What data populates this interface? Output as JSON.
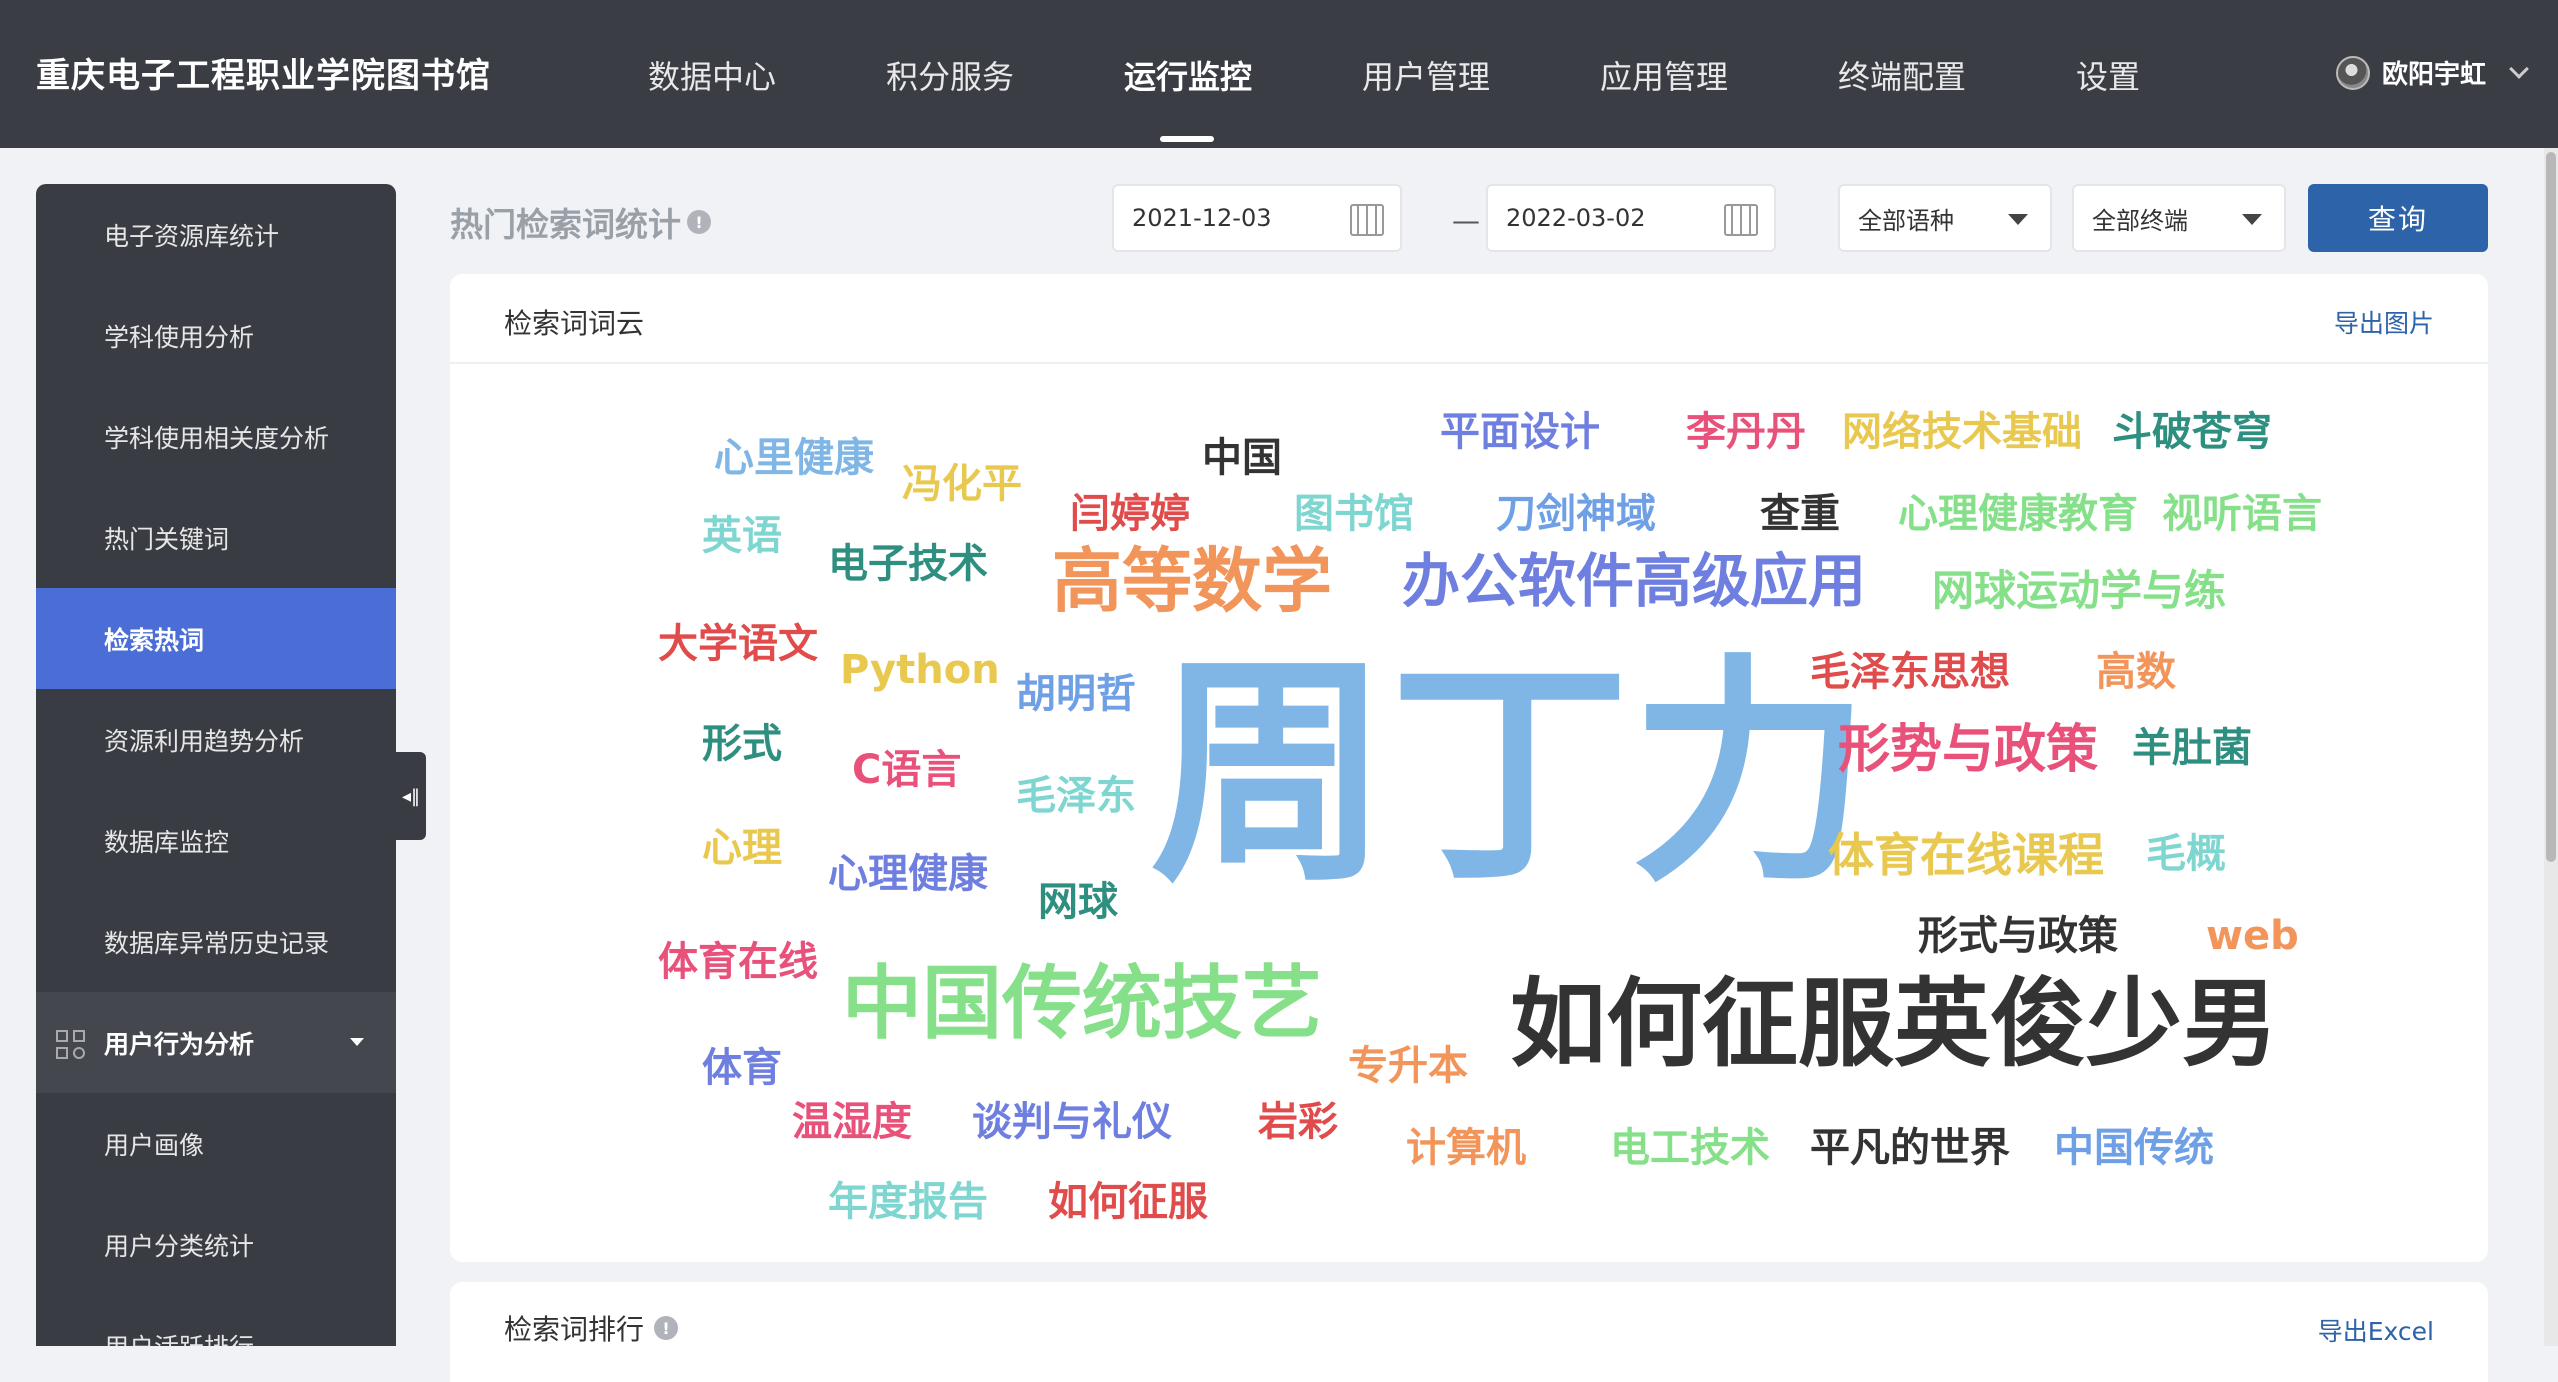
{
  "header": {
    "brand": "重庆电子工程职业学院图书馆",
    "nav": [
      {
        "label": "数据中心"
      },
      {
        "label": "积分服务"
      },
      {
        "label": "运行监控",
        "active": true
      },
      {
        "label": "用户管理"
      },
      {
        "label": "应用管理"
      },
      {
        "label": "终端配置"
      },
      {
        "label": "设置"
      }
    ],
    "user_name": "欧阳宇虹"
  },
  "sidebar": {
    "items": [
      {
        "label": "电子资源库统计"
      },
      {
        "label": "学科使用分析"
      },
      {
        "label": "学科使用相关度分析"
      },
      {
        "label": "热门关键词"
      },
      {
        "label": "检索热词",
        "active": true
      },
      {
        "label": "资源利用趋势分析"
      },
      {
        "label": "数据库监控"
      },
      {
        "label": "数据库异常历史记录"
      },
      {
        "label": "用户行为分析",
        "group": true
      },
      {
        "label": "用户画像"
      },
      {
        "label": "用户分类统计"
      },
      {
        "label": "用户活跃排行"
      }
    ]
  },
  "toolbar": {
    "page_title": "热门检索词统计",
    "start_date": "2021-12-03",
    "end_date": "2022-03-02",
    "dash": "—",
    "language_select": "全部语种",
    "terminal_select": "全部终端",
    "query_label": "查询"
  },
  "word_cloud_card": {
    "title": "检索词词云",
    "export_label": "导出图片",
    "words": [
      {
        "text": "周丁力",
        "color": "#7fb6e6"
      },
      {
        "text": "如何征服英俊少男",
        "color": "#333333"
      },
      {
        "text": "中国传统技艺",
        "color": "#86e08a"
      },
      {
        "text": "高等数学",
        "color": "#f2955a"
      },
      {
        "text": "办公软件高级应用",
        "color": "#6f7fe0"
      },
      {
        "text": "形势与政策",
        "color": "#e8527a"
      },
      {
        "text": "体育在线课程",
        "color": "#e8c84f"
      },
      {
        "text": "网球运动学与练",
        "color": "#86e08a"
      },
      {
        "text": "毛泽东思想",
        "color": "#e04c4c"
      },
      {
        "text": "心理健康教育",
        "color": "#86e08a"
      },
      {
        "text": "视听语言",
        "color": "#86e08a"
      },
      {
        "text": "网络技术基础",
        "color": "#e8c84f"
      },
      {
        "text": "斗破苍穹",
        "color": "#2e8f80"
      },
      {
        "text": "李丹丹",
        "color": "#e8527a"
      },
      {
        "text": "平面设计",
        "color": "#6f7fe0"
      },
      {
        "text": "刀剑神域",
        "color": "#6fa0e6"
      },
      {
        "text": "查重",
        "color": "#333333"
      },
      {
        "text": "图书馆",
        "color": "#7fd6d0"
      },
      {
        "text": "闫婷婷",
        "color": "#e04c4c"
      },
      {
        "text": "中国",
        "color": "#333333"
      },
      {
        "text": "冯化平",
        "color": "#e8c84f"
      },
      {
        "text": "心里健康",
        "color": "#7fb6e6"
      },
      {
        "text": "英语",
        "color": "#7fd6d0"
      },
      {
        "text": "电子技术",
        "color": "#2e8f80"
      },
      {
        "text": "大学语文",
        "color": "#e04c4c"
      },
      {
        "text": "Python",
        "color": "#e8c84f"
      },
      {
        "text": "胡明哲",
        "color": "#6fa0e6"
      },
      {
        "text": "形式",
        "color": "#2e8f80"
      },
      {
        "text": "C语言",
        "color": "#e8527a"
      },
      {
        "text": "毛泽东",
        "color": "#7fd6d0"
      },
      {
        "text": "心理",
        "color": "#e8c84f"
      },
      {
        "text": "心理健康",
        "color": "#6f7fe0"
      },
      {
        "text": "网球",
        "color": "#2e8f80"
      },
      {
        "text": "高数",
        "color": "#f2955a"
      },
      {
        "text": "羊肚菌",
        "color": "#2e8f80"
      },
      {
        "text": "毛概",
        "color": "#7fd6d0"
      },
      {
        "text": "形式与政策",
        "color": "#333333"
      },
      {
        "text": "web",
        "color": "#f2955a"
      },
      {
        "text": "体育在线",
        "color": "#e8527a"
      },
      {
        "text": "专升本",
        "color": "#f2955a"
      },
      {
        "text": "体育",
        "color": "#6f7fe0"
      },
      {
        "text": "温湿度",
        "color": "#e8527a"
      },
      {
        "text": "谈判与礼仪",
        "color": "#6f7fe0"
      },
      {
        "text": "岩彩",
        "color": "#e04c4c"
      },
      {
        "text": "计算机",
        "color": "#f2955a"
      },
      {
        "text": "电工技术",
        "color": "#86e08a"
      },
      {
        "text": "平凡的世界",
        "color": "#333333"
      },
      {
        "text": "中国传统",
        "color": "#6fa0e6"
      },
      {
        "text": "年度报告",
        "color": "#7fd6d0"
      },
      {
        "text": "如何征服",
        "color": "#e04c4c"
      }
    ]
  },
  "ranking_card": {
    "title": "检索词排行",
    "export_label": "导出Excel"
  }
}
